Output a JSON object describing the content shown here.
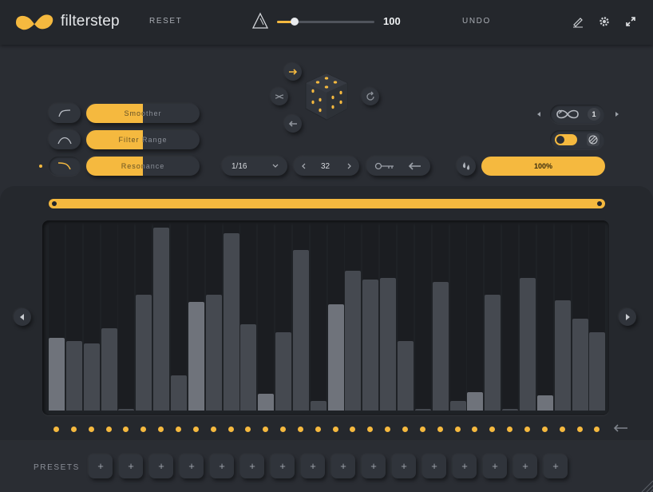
{
  "app": {
    "name": "filterstep"
  },
  "header": {
    "reset_label": "RESET",
    "undo_label": "UNDO",
    "gain": {
      "value": "100",
      "level": 0.18
    },
    "icons": [
      "pencil-icon",
      "gear-icon",
      "resize-icon"
    ]
  },
  "filter": {
    "smoother": {
      "label": "Smoother",
      "level": 0.5
    },
    "filter_range": {
      "label": "Filter Range",
      "level": 0.5
    },
    "resonance": {
      "label": "Resonance",
      "level": 0.5
    }
  },
  "sequence": {
    "rate": "1/16",
    "steps": "32",
    "loop_count": "1",
    "mix": "100%"
  },
  "steps": {
    "heights": [
      0.39,
      0.37,
      0.36,
      0.44,
      0.01,
      0.62,
      0.98,
      0.19,
      0.58,
      0.62,
      0.95,
      0.46,
      0.09,
      0.42,
      0.86,
      0.05,
      0.57,
      0.75,
      0.7,
      0.71,
      0.37,
      0.01,
      0.69,
      0.05,
      0.1,
      0.62,
      0.01,
      0.71,
      0.08,
      0.59,
      0.49,
      0.42
    ],
    "highlighted": [
      0,
      8,
      12,
      16,
      24,
      28
    ]
  },
  "presets": {
    "label": "PRESETS",
    "slot_symbol": "+",
    "slots": 16
  },
  "colors": {
    "accent": "#f5b93f",
    "background": "#2a2d33",
    "panel": "#25282d"
  }
}
